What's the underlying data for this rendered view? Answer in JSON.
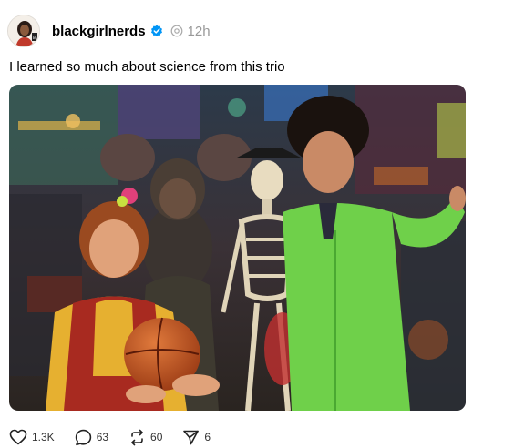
{
  "post": {
    "username": "blackgirlnerds",
    "time": "12h",
    "caption": "I learned so much about science from this trio"
  },
  "actions": {
    "likes": "1.3K",
    "comments": "63",
    "reposts": "60",
    "shares": "6"
  },
  "icons": {
    "verified": "verified-badge-icon",
    "threads": "threads-logo-icon",
    "like": "heart-icon",
    "comment": "comment-bubble-icon",
    "repost": "repost-arrows-icon",
    "share": "send-plane-icon"
  },
  "colors": {
    "verified_blue": "#0095f6",
    "muted_text": "#999999"
  }
}
